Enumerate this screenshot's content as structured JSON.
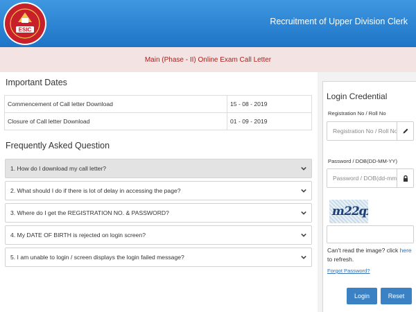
{
  "header": {
    "title": "Recruitment of Upper Division Clerk",
    "logo_text": "ESIC",
    "colors": {
      "bar": "#2a82d3",
      "logo_red": "#c7202b",
      "logo_gold": "#f2c24a"
    }
  },
  "subheader": {
    "title": "Main (Phase - II) Online Exam Call Letter",
    "color": "#a3221f"
  },
  "important_dates": {
    "title": "Important Dates",
    "rows": [
      {
        "label": "Commencement of Call letter Download",
        "date": "15 - 08 - 2019"
      },
      {
        "label": "Closure of Call letter Download",
        "date": "01 - 09 - 2019"
      }
    ]
  },
  "faq": {
    "title": "Frequently Asked Question",
    "items": [
      "1. How do I download my call letter?",
      "2. What should I do if there is lot of delay in accessing the page?",
      "3. Where do I get the REGISTRATION NO. & PASSWORD?",
      "4. My DATE OF BIRTH is rejected on login screen?",
      "5. I am unable to login / screen displays the login failed message?"
    ]
  },
  "login": {
    "title": "Login Credential",
    "reg_label": "Registration No / Roll No",
    "reg_placeholder": "Registration No / Roll No",
    "pass_label": "Password / DOB(DD-MM-YY)",
    "pass_placeholder": "Password / DOB(dd-mm-yy)",
    "captcha_text": "m22qx",
    "captcha_value": "",
    "cant_read_prefix": "Can't read the image? click ",
    "cant_read_link": "here",
    "cant_read_suffix": " to refresh.",
    "forgot": "Forgot Password?",
    "login_button": "Login",
    "reset_button": "Reset",
    "button_color": "#3b82c4",
    "icons": {
      "reg": "pencil-icon",
      "pass": "lock-icon"
    }
  }
}
